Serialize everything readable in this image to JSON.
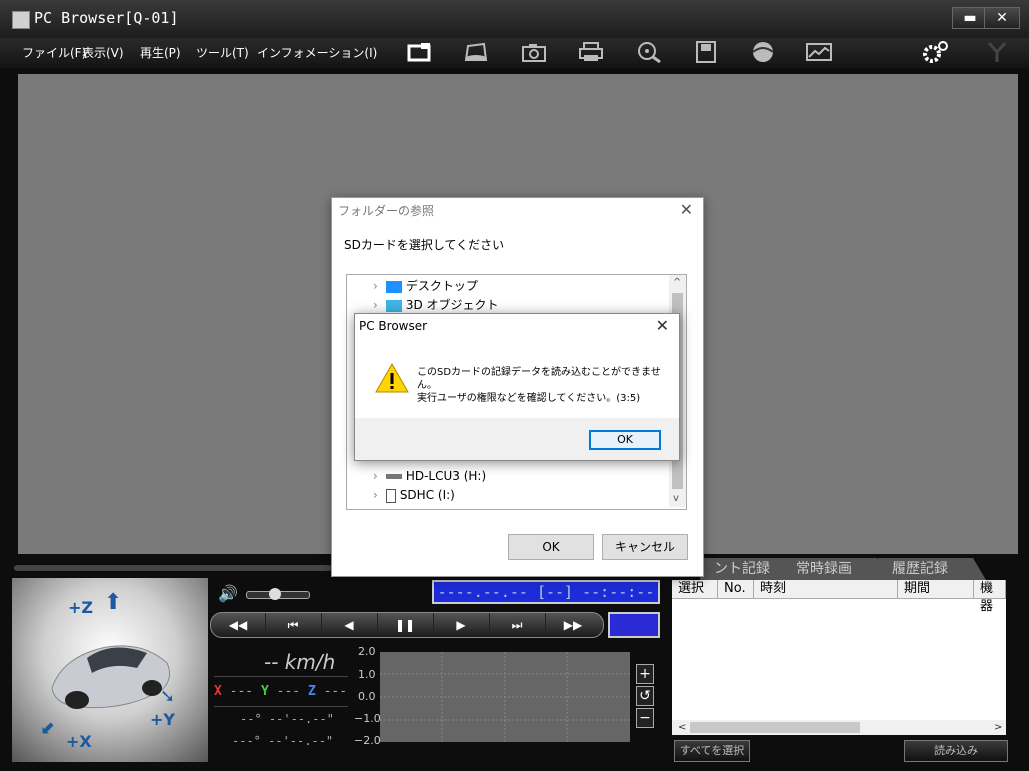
{
  "window": {
    "title": "PC Browser[Q-01]",
    "minimize": "▬",
    "close": "✕"
  },
  "menu": [
    "ファイル(F)",
    "表示(V)",
    "再生(P)",
    "ツール(T)",
    "インフォメーション(I)"
  ],
  "toolbar_icons": [
    "sd-card-icon",
    "screen-icon",
    "camera-icon",
    "print-icon",
    "film-search-icon",
    "save-icon",
    "globe-icon",
    "map-icon",
    "settings-icon",
    "antenna-icon"
  ],
  "tabs": [
    "ント記録",
    "常時録画",
    "履歴記録"
  ],
  "grid": {
    "columns": [
      "選択",
      "No.",
      "時刻",
      "期間",
      "機器"
    ]
  },
  "buttons": {
    "select_all": "すべてを選択",
    "load": "読み込み"
  },
  "player": {
    "timecode": "----.--.-- [--] --:--:--",
    "controls": [
      "◀◀",
      "⏮",
      "◀",
      "❚❚",
      "▶",
      "⏭",
      "▶▶"
    ],
    "speed": "-- km/h",
    "axes": {
      "x": "X",
      "y": "Y",
      "z": "Z",
      "val": "---"
    },
    "coord1": "--°  --'--.--\"",
    "coord2": "---°  --'--.--\"",
    "gscale": [
      "2.0",
      "1.0",
      "0.0",
      "−1.0",
      "−2.0"
    ],
    "zoom": [
      "+",
      "↺",
      "−"
    ]
  },
  "car_axes": {
    "z": "+Z",
    "y": "+Y",
    "x": "+X"
  },
  "folder_dialog": {
    "title": "フォルダーの参照",
    "prompt": "SDカードを選択してください",
    "items_top": [
      "デスクトップ",
      "3D オブジェクト"
    ],
    "items_bottom": [
      "HD-LCU3 (H:)",
      "SDHC (I:)"
    ],
    "ok": "OK",
    "cancel": "キャンセル"
  },
  "message": {
    "title": "PC Browser",
    "line1": "このSDカードの記録データを読み込むことができません。",
    "line2": "実行ユーザの権限などを確認してください。(3:5)",
    "ok": "OK"
  },
  "colors": {
    "timebox": "#1b2cd8",
    "accent_blue": "#0078d7"
  }
}
